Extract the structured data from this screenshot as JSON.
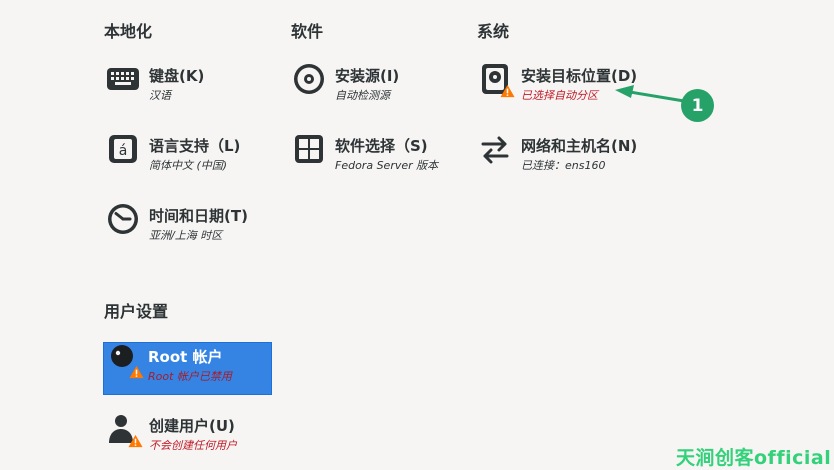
{
  "sections": {
    "localization": "本地化",
    "software": "软件",
    "system": "系统",
    "user_settings": "用户设置"
  },
  "spokes": {
    "keyboard": {
      "label": "键盘(K)",
      "status": "汉语",
      "icon": "keyboard-icon"
    },
    "language": {
      "label": "语言支持（L)",
      "status": "简体中文 (中国)",
      "icon": "language-icon"
    },
    "time": {
      "label": "时间和日期(T)",
      "status": "亚洲/上海 时区",
      "icon": "clock-icon"
    },
    "source": {
      "label": "安装源(I)",
      "status": "自动检测源",
      "icon": "disc-icon"
    },
    "software_selection": {
      "label": "软件选择（S)",
      "status": "Fedora Server 版本",
      "icon": "package-icon"
    },
    "destination": {
      "label": "安装目标位置(D)",
      "status": "已选择自动分区",
      "icon": "harddisk-icon"
    },
    "network": {
      "label": "网络和主机名(N)",
      "status": "已连接：ens160",
      "icon": "network-arrows-icon"
    },
    "root": {
      "label": "Root 帐户",
      "status": "Root 帐户已禁用",
      "icon": "root-user-icon"
    },
    "user": {
      "label": "创建用户(U)",
      "status": "不会创建任何用户",
      "icon": "user-icon"
    }
  },
  "annotation": {
    "number": "1"
  },
  "watermark": "天涧创客official",
  "colors": {
    "background": "#f6f5f4",
    "selection": "#3584e4",
    "warning_text": "#c01c28",
    "warning_icon": "#ff7800",
    "annotation": "#26a269"
  }
}
